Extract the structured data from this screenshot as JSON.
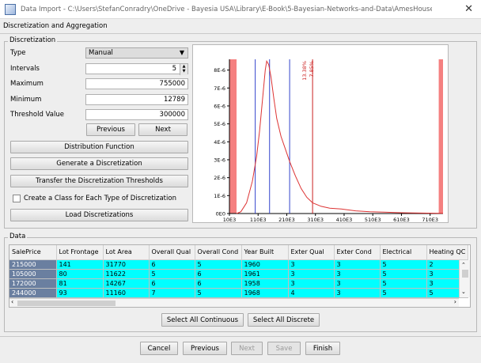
{
  "window": {
    "title": "Data Import - C:\\Users\\StefanConradry\\OneDrive - Bayesia USA\\Library\\E-Book\\5-Bayesian-Networks-and-Data\\AmesHousePriceData.c..."
  },
  "page": {
    "subtitle": "Discretization and Aggregation"
  },
  "discretization": {
    "legend": "Discretization",
    "type_label": "Type",
    "type_value": "Manual",
    "intervals_label": "Intervals",
    "intervals_value": "5",
    "maximum_label": "Maximum",
    "maximum_value": "755000",
    "minimum_label": "Minimum",
    "minimum_value": "12789",
    "threshold_label": "Threshold Value",
    "threshold_value": "300000",
    "previous_label": "Previous",
    "next_label": "Next",
    "distribution_label": "Distribution Function",
    "generate_label": "Generate a Discretization",
    "transfer_label": "Transfer the Discretization Thresholds",
    "create_class_label": "Create a Class for Each Type of Discretization",
    "create_class_checked": false,
    "load_label": "Load Discretizations"
  },
  "chart_data": {
    "type": "line",
    "y_ticks": [
      "0E0",
      "1E-6",
      "2E-6",
      "3E-6",
      "4E-6",
      "5E-6",
      "6E-6",
      "7E-6",
      "8E-6"
    ],
    "x_ticks": [
      "10E3",
      "110E3",
      "210E3",
      "310E3",
      "410E3",
      "510E3",
      "610E3",
      "710E3"
    ],
    "xlim": [
      10000,
      755000
    ],
    "ylim": [
      0,
      8.6
    ],
    "density_x": [
      34900,
      50000,
      70000,
      90000,
      105000,
      115000,
      125000,
      135000,
      140000,
      147000,
      155000,
      165000,
      175000,
      190000,
      205000,
      220000,
      240000,
      260000,
      280000,
      300000,
      330000,
      360000,
      400000,
      450000,
      500000,
      550000,
      600000,
      650000,
      700000,
      755000
    ],
    "density_y": [
      0.0,
      0.1,
      0.6,
      1.8,
      3.2,
      4.6,
      6.3,
      8.0,
      8.5,
      8.3,
      7.6,
      6.4,
      5.3,
      4.3,
      3.6,
      2.9,
      2.1,
      1.4,
      0.9,
      0.6,
      0.4,
      0.3,
      0.25,
      0.15,
      0.1,
      0.08,
      0.05,
      0.03,
      0.02,
      0.01
    ],
    "excluded_ranges": [
      [
        10000,
        34900
      ],
      [
        740000,
        755000
      ]
    ],
    "blue_thresholds": [
      100000,
      150000,
      220000
    ],
    "red_threshold": 300000,
    "annotations": [
      "13.38%",
      "7.85%"
    ],
    "colors": {
      "density": "#dd3333",
      "threshold": "#3344cc",
      "red": "#cc2222",
      "excluded": "#f58080"
    }
  },
  "data": {
    "legend": "Data",
    "columns": [
      "SalePrice",
      "Lot Frontage",
      "Lot Area",
      "Overall Qual",
      "Overall Cond",
      "Year Built",
      "Exter Qual",
      "Exter Cond",
      "Electrical",
      "Heating QC"
    ],
    "rows": [
      [
        "215000",
        "141",
        "31770",
        "6",
        "5",
        "1960",
        "3",
        "3",
        "5",
        "2"
      ],
      [
        "105000",
        "80",
        "11622",
        "5",
        "6",
        "1961",
        "3",
        "3",
        "5",
        "3"
      ],
      [
        "172000",
        "81",
        "14267",
        "6",
        "6",
        "1958",
        "3",
        "3",
        "5",
        "3"
      ],
      [
        "244000",
        "93",
        "11160",
        "7",
        "5",
        "1968",
        "4",
        "3",
        "5",
        "5"
      ]
    ],
    "select_continuous_label": "Select All Continuous",
    "select_discrete_label": "Select All Discrete"
  },
  "footer": {
    "cancel_label": "Cancel",
    "previous_label": "Previous",
    "next_label": "Next",
    "save_label": "Save",
    "finish_label": "Finish"
  }
}
